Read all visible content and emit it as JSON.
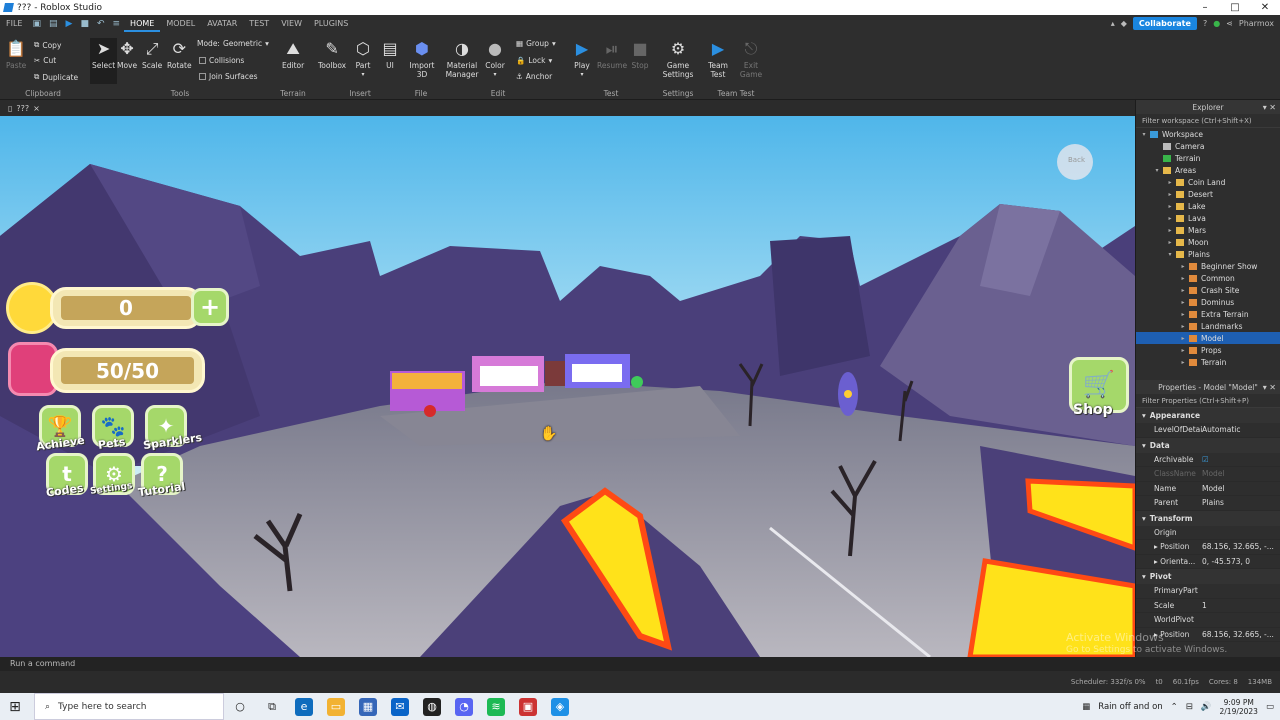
{
  "window": {
    "title": "??? - Roblox Studio",
    "min": "–",
    "max": "□",
    "close": "✕"
  },
  "menubar": {
    "file": "FILE",
    "tabs": [
      "HOME",
      "MODEL",
      "AVATAR",
      "TEST",
      "VIEW",
      "PLUGINS"
    ],
    "collaborate": "Collaborate",
    "user": "Pharmox"
  },
  "ribbon": {
    "clipboard": {
      "paste": "Paste",
      "copy": "Copy",
      "cut": "Cut",
      "duplicate": "Duplicate",
      "group": "Clipboard"
    },
    "tools": {
      "select": "Select",
      "move": "Move",
      "scale": "Scale",
      "rotate": "Rotate",
      "mode_label": "Mode:",
      "mode_value": "Geometric",
      "collisions": "Collisions",
      "join": "Join Surfaces",
      "group": "Tools"
    },
    "terrain": {
      "editor": "Editor",
      "group": "Terrain"
    },
    "insert": {
      "toolbox": "Toolbox",
      "part": "Part",
      "ui": "UI",
      "group": "Insert"
    },
    "file": {
      "import": "Import 3D",
      "group": "File"
    },
    "edit": {
      "material": "Material Manager",
      "color": "Color",
      "grp": "Group",
      "lock": "Lock",
      "anchor": "Anchor",
      "group": "Edit"
    },
    "test": {
      "play": "Play",
      "resume": "Resume",
      "stop": "Stop",
      "group": "Test"
    },
    "settings": {
      "game": "Game Settings",
      "group": "Settings"
    },
    "teamtest": {
      "team": "Team Test",
      "exit": "Exit Game",
      "group": "Team Test"
    }
  },
  "doc_tab": {
    "label": "???",
    "close": "×"
  },
  "hud": {
    "coins": "0",
    "capacity": "50/50",
    "plus": "+",
    "buttons": [
      "Achieve",
      "Pets",
      "Sparklers",
      "Codes",
      "Settings",
      "Tutorial"
    ],
    "shop": "Shop",
    "map_label": "Back"
  },
  "explorer": {
    "title": "Explorer",
    "filter": "Filter workspace (Ctrl+Shift+X)",
    "items": [
      {
        "label": "Workspace",
        "depth": 0,
        "arrow": "▾",
        "icon": "#3a9ad9"
      },
      {
        "label": "Camera",
        "depth": 1,
        "arrow": "",
        "icon": "#bbbbbb"
      },
      {
        "label": "Terrain",
        "depth": 1,
        "arrow": "",
        "icon": "#39b54a"
      },
      {
        "label": "Areas",
        "depth": 1,
        "arrow": "▾",
        "icon": "#e6b84a"
      },
      {
        "label": "Coin Land",
        "depth": 2,
        "arrow": "▸",
        "icon": "#e6b84a"
      },
      {
        "label": "Desert",
        "depth": 2,
        "arrow": "▸",
        "icon": "#e6b84a"
      },
      {
        "label": "Lake",
        "depth": 2,
        "arrow": "▸",
        "icon": "#e6b84a"
      },
      {
        "label": "Lava",
        "depth": 2,
        "arrow": "▸",
        "icon": "#e6b84a"
      },
      {
        "label": "Mars",
        "depth": 2,
        "arrow": "▸",
        "icon": "#e6b84a"
      },
      {
        "label": "Moon",
        "depth": 2,
        "arrow": "▸",
        "icon": "#e6b84a"
      },
      {
        "label": "Plains",
        "depth": 2,
        "arrow": "▾",
        "icon": "#e6b84a"
      },
      {
        "label": "Beginner Show",
        "depth": 3,
        "arrow": "▸",
        "icon": "#e08a3c"
      },
      {
        "label": "Common",
        "depth": 3,
        "arrow": "▸",
        "icon": "#e08a3c"
      },
      {
        "label": "Crash Site",
        "depth": 3,
        "arrow": "▸",
        "icon": "#e08a3c"
      },
      {
        "label": "Dominus",
        "depth": 3,
        "arrow": "▸",
        "icon": "#e08a3c"
      },
      {
        "label": "Extra Terrain",
        "depth": 3,
        "arrow": "▸",
        "icon": "#e08a3c"
      },
      {
        "label": "Landmarks",
        "depth": 3,
        "arrow": "▸",
        "icon": "#e08a3c"
      },
      {
        "label": "Model",
        "depth": 3,
        "arrow": "▸",
        "icon": "#e08a3c",
        "selected": true
      },
      {
        "label": "Props",
        "depth": 3,
        "arrow": "▸",
        "icon": "#e08a3c"
      },
      {
        "label": "Terrain",
        "depth": 3,
        "arrow": "▸",
        "icon": "#e08a3c"
      }
    ]
  },
  "properties": {
    "title": "Properties - Model \"Model\"",
    "filter": "Filter Properties (Ctrl+Shift+P)",
    "sections": [
      {
        "name": "Appearance",
        "rows": [
          {
            "k": "LevelOfDetail",
            "v": "Automatic"
          }
        ]
      },
      {
        "name": "Data",
        "rows": [
          {
            "k": "Archivable",
            "v": "☑"
          },
          {
            "k": "ClassName",
            "v": "Model",
            "dim": true
          },
          {
            "k": "Name",
            "v": "Model"
          },
          {
            "k": "Parent",
            "v": "Plains"
          }
        ]
      },
      {
        "name": "Transform",
        "rows": [
          {
            "k": "Origin",
            "v": ""
          },
          {
            "k": "▸ Position",
            "v": "68.156, 32.665, -..."
          },
          {
            "k": "▸ Orienta...",
            "v": "0, -45.573, 0"
          }
        ]
      },
      {
        "name": "Pivot",
        "rows": [
          {
            "k": "PrimaryPart",
            "v": ""
          },
          {
            "k": "Scale",
            "v": "1"
          },
          {
            "k": "WorldPivot",
            "v": ""
          },
          {
            "k": "▸ Position",
            "v": "68.156, 32.665, -..."
          }
        ]
      }
    ]
  },
  "command": {
    "placeholder": "Run a command"
  },
  "status": {
    "scheduler": "Scheduler: 332f/s 0%",
    "t": "t0",
    "fps": "60.1fps",
    "cores": "Cores: 8",
    "mem": "134MB"
  },
  "watermark": {
    "line1": "Activate Windows",
    "line2": "Go to Settings to activate Windows."
  },
  "taskbar": {
    "search": "Type here to search",
    "weather": "Rain off and on",
    "time": "9:09 PM",
    "date": "2/19/2023"
  }
}
